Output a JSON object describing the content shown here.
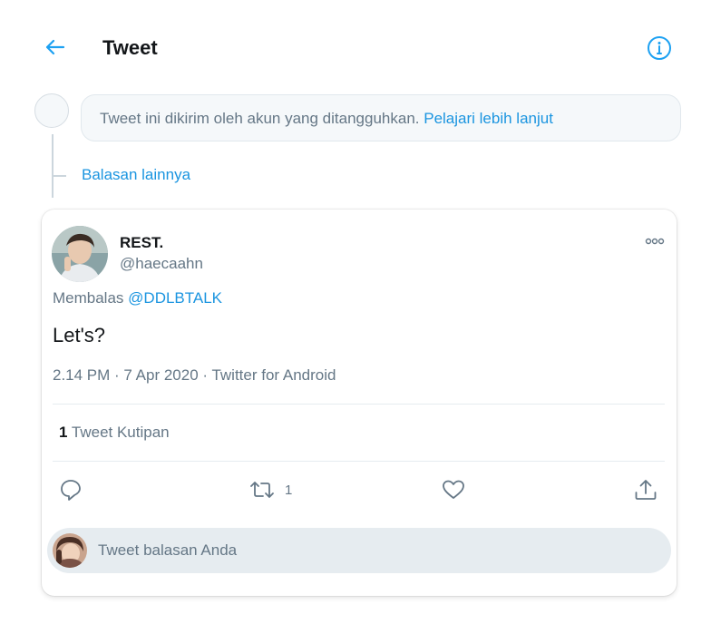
{
  "header": {
    "title": "Tweet",
    "back_icon": "arrow-left-icon",
    "info_icon": "info-icon",
    "accent_color": "#1da1f2"
  },
  "thread": {
    "suspended_text": "Tweet ini dikirim oleh akun yang ditangguhkan.",
    "suspended_link": "Pelajari lebih lanjut",
    "more_replies": "Balasan lainnya"
  },
  "tweet": {
    "author_name": "REST.",
    "author_handle": "@haecaahn",
    "reply_prefix": "Membalas",
    "reply_mention": "@DDLBTALK",
    "text": "Let's?",
    "meta": "2.14 PM · 7 Apr 2020 · Twitter for Android",
    "quote_count": "1",
    "quote_label": "Tweet Kutipan",
    "actions": {
      "reply_icon": "reply-icon",
      "retweet_icon": "retweet-icon",
      "retweet_count": "1",
      "like_icon": "heart-icon",
      "share_icon": "share-icon"
    }
  },
  "reply_box": {
    "placeholder": "Tweet balasan Anda"
  }
}
